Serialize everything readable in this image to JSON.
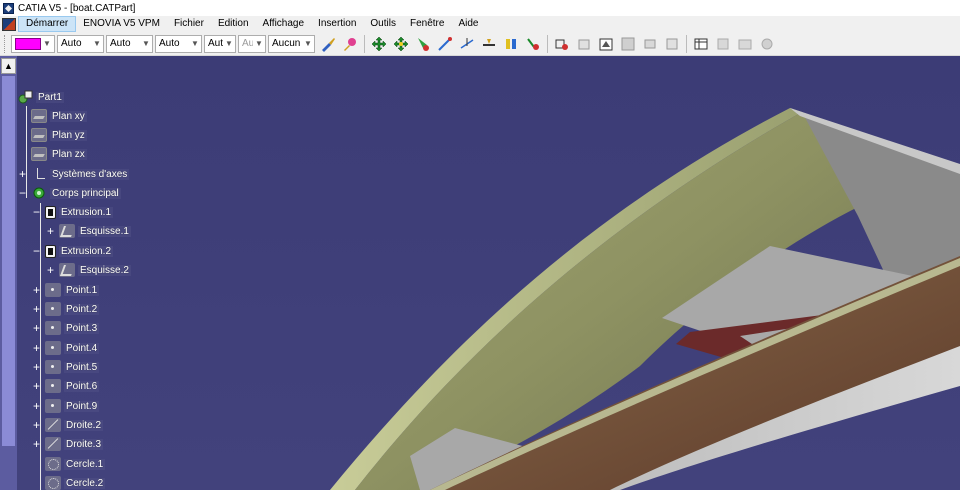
{
  "window": {
    "title": "CATIA V5 - [boat.CATPart]"
  },
  "menu": {
    "items": [
      {
        "label": "Démarrer"
      },
      {
        "label": "ENOVIA V5 VPM"
      },
      {
        "label": "Fichier"
      },
      {
        "label": "Edition"
      },
      {
        "label": "Affichage"
      },
      {
        "label": "Insertion"
      },
      {
        "label": "Outils"
      },
      {
        "label": "Fenêtre"
      },
      {
        "label": "Aide"
      }
    ]
  },
  "toolbar": {
    "color_value": "#ff00ff",
    "combos": [
      {
        "value": "Auto"
      },
      {
        "value": "Auto"
      },
      {
        "value": "Auto"
      },
      {
        "value": "Aut"
      },
      {
        "value": "Aut"
      },
      {
        "value": "Aucun"
      }
    ]
  },
  "tree": {
    "root": "Part1",
    "nodes": [
      {
        "label": "Plan xy"
      },
      {
        "label": "Plan yz"
      },
      {
        "label": "Plan zx"
      },
      {
        "label": "Systèmes d'axes"
      },
      {
        "label": "Corps principal"
      },
      {
        "label": "Extrusion.1"
      },
      {
        "label": "Esquisse.1"
      },
      {
        "label": "Extrusion.2"
      },
      {
        "label": "Esquisse.2"
      },
      {
        "label": "Point.1"
      },
      {
        "label": "Point.2"
      },
      {
        "label": "Point.3"
      },
      {
        "label": "Point.4"
      },
      {
        "label": "Point.5"
      },
      {
        "label": "Point.6"
      },
      {
        "label": "Point.9"
      },
      {
        "label": "Droite.2"
      },
      {
        "label": "Droite.3"
      },
      {
        "label": "Cercle.1"
      },
      {
        "label": "Cercle.2"
      }
    ]
  },
  "colors": {
    "background": "#3e3e78",
    "hull_inner": "#9a9a6a",
    "hull_outer": "#7a5540",
    "seat": "#a8a8a8",
    "wood": "#6b2a2a"
  }
}
